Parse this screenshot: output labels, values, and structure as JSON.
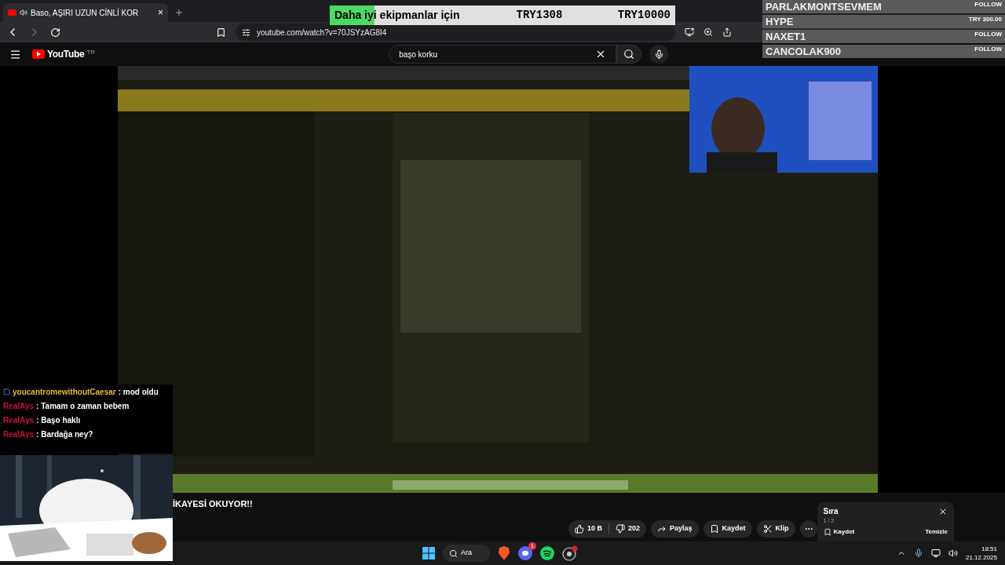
{
  "browser": {
    "tab": {
      "title": "Baso, AŞIRI UZUN CİNLİ KOR",
      "close": "×"
    },
    "url": "youtube.com/watch?v=70JSYzAG8I4"
  },
  "youtube": {
    "logo": "YouTube",
    "region": "TR",
    "search": {
      "value": "başo korku"
    }
  },
  "donation_goal": {
    "label_filled": "Daha iyi",
    "label_rest": " ekipmanlar için",
    "current": "TRY1308",
    "target": "TRY10000",
    "level": 0.13
  },
  "recent_events": [
    {
      "name": "PARLAKMONTSEVMEM",
      "tag": "FOLLOW"
    },
    {
      "name": "HYPE",
      "tag": "TRY 300.00"
    },
    {
      "name": "NAXET1",
      "tag": "FOLLOW"
    },
    {
      "name": "CANCOLAK900",
      "tag": "FOLLOW"
    }
  ],
  "chat": [
    {
      "user": "youcantromewithoutCaesar",
      "message": ": mod oldu",
      "color": "#e8b83a",
      "badge": true
    },
    {
      "user": "RealAys",
      "message": ": Tamam o zaman bebem",
      "color": "#c8103e",
      "badge": false
    },
    {
      "user": "RealAys",
      "message": ": Başo haklı",
      "color": "#c8103e",
      "badge": false
    },
    {
      "user": "RealAys",
      "message": ": Bardağa ney?",
      "color": "#c8103e",
      "badge": false
    }
  ],
  "video_title": "İKAYESİ OKUYOR!!",
  "actions": {
    "likes": "10 B",
    "dislikes": "202",
    "share": "Paylaş",
    "save": "Kaydet",
    "clip": "Klip"
  },
  "queue": {
    "title": "Sıra",
    "position": "1 / 2",
    "save": "Kaydet",
    "clear": "Temizle"
  },
  "taskbar": {
    "search": "Ara",
    "notifications": "1",
    "time": "18:51",
    "date": "21.12.2025"
  }
}
